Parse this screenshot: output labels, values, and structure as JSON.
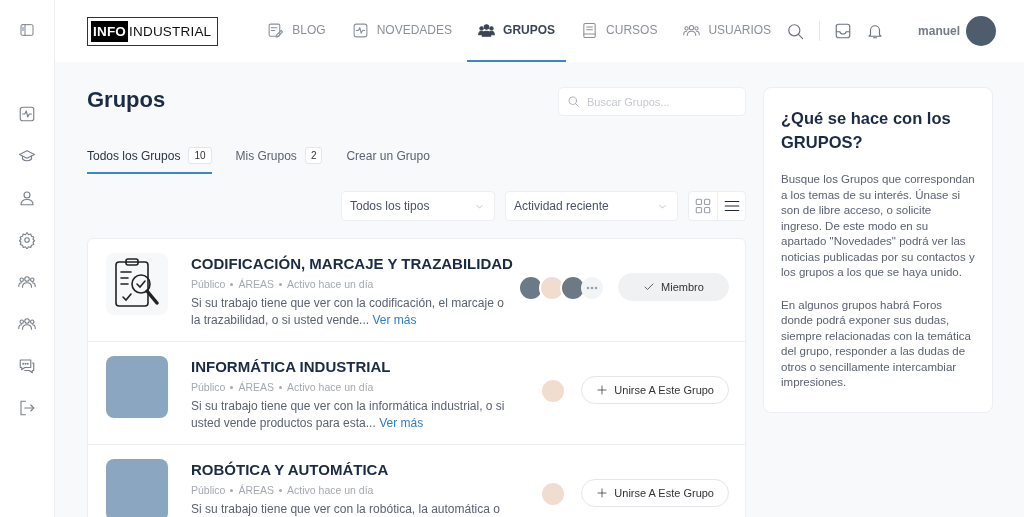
{
  "header": {
    "logo": {
      "highlight": "INFO",
      "text": "INDUSTRIAL"
    },
    "nav": [
      {
        "label": "BLOG",
        "kind": "blog",
        "selected": false
      },
      {
        "label": "NOVEDADES",
        "kind": "activity",
        "selected": false
      },
      {
        "label": "GRUPOS",
        "kind": "groups",
        "selected": true
      },
      {
        "label": "CURSOS",
        "kind": "book",
        "selected": false
      },
      {
        "label": "USUARIOS",
        "kind": "users",
        "selected": false
      }
    ],
    "user": {
      "name": "manuel"
    }
  },
  "page": {
    "title": "Grupos",
    "search": {
      "placeholder": "Buscar Grupos..."
    },
    "tabs": [
      {
        "label": "Todos los Grupos",
        "count": "10",
        "selected": true
      },
      {
        "label": "Mis Grupos",
        "count": "2",
        "selected": false
      },
      {
        "label": "Crear un Grupo",
        "selected": false
      }
    ],
    "filters": [
      {
        "value": "Todos los tipos"
      },
      {
        "value": "Actividad reciente"
      }
    ],
    "view_modes": [
      {
        "kind": "grid",
        "selected": false
      },
      {
        "kind": "list",
        "selected": true
      }
    ]
  },
  "groups": [
    {
      "title": "CODIFICACIÓN, MARCAJE Y TRAZABILIDAD",
      "image": {
        "kind": "icon"
      },
      "privacy": "Público",
      "category": "ÁREAS",
      "activity": "Activo hace un día",
      "description": "Si su trabajo tiene que ver con la codificación, el marcaje o la trazabilidad, o si usted vende...",
      "more": "Ver más",
      "members": [
        {
          "kind": "photo"
        },
        {
          "kind": "cartoon"
        },
        {
          "kind": "photo"
        },
        {
          "kind": "more"
        }
      ],
      "action": {
        "kind": "member",
        "label": "Miembro"
      }
    },
    {
      "title": "INFORMÁTICA INDUSTRIAL",
      "image": {
        "kind": "photo"
      },
      "privacy": "Público",
      "category": "ÁREAS",
      "activity": "Activo hace un día",
      "description": "Si su trabajo tiene que ver con la informática industrial, o si usted vende productos para esta...",
      "more": "Ver más",
      "members": [
        {
          "kind": "cartoon"
        }
      ],
      "action": {
        "kind": "join",
        "label": "Unirse A Este Grupo"
      }
    },
    {
      "title": "ROBÓTICA Y AUTOMÁTICA",
      "image": {
        "kind": "photo"
      },
      "privacy": "Público",
      "category": "ÁREAS",
      "activity": "Activo hace un día",
      "description": "Si su trabajo tiene que ver con la robótica, la automática o",
      "members": [
        {
          "kind": "cartoon"
        }
      ],
      "action": {
        "kind": "join",
        "label": "Unirse A Este Grupo"
      }
    }
  ],
  "info": {
    "title": "¿Qué se hace con los GRUPOS?",
    "paragraphs": [
      "Busque los Grupos que correspondan a los temas de su interés. Únase si son de libre acceso, o solicite ingreso. De este modo en su apartado \"Novedades\" podrá ver las noticias publicadas por su contactos y los grupos a los que se haya unido.",
      "En algunos grupos habrá Foros donde podrá exponer sus dudas, siempre relacionadas con la temática del grupo, responder a las dudas de otros o sencillamente intercambiar impresiones."
    ]
  }
}
